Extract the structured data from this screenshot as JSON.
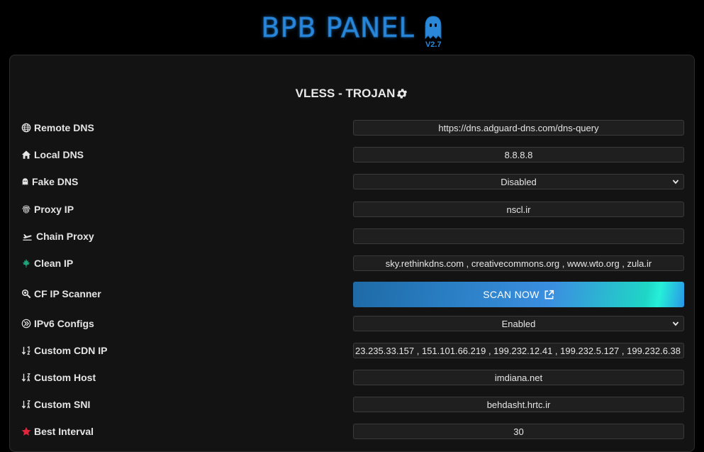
{
  "header": {
    "logo": "BPB PANEL",
    "version": "V2.7"
  },
  "section": {
    "title": "VLESS - TROJAN"
  },
  "rows": {
    "remote_dns": {
      "label": "Remote DNS",
      "value": "https://dns.adguard-dns.com/dns-query"
    },
    "local_dns": {
      "label": "Local DNS",
      "value": "8.8.8.8"
    },
    "fake_dns": {
      "label": "Fake DNS",
      "value": "Disabled"
    },
    "proxy_ip": {
      "label": "Proxy IP",
      "value": "nscl.ir"
    },
    "chain_proxy": {
      "label": "Chain Proxy",
      "value": ""
    },
    "clean_ip": {
      "label": "Clean IP",
      "value": "sky.rethinkdns.com , creativecommons.org , www.wto.org , zula.ir"
    },
    "cf_scanner": {
      "label": "CF IP Scanner",
      "button": "SCAN NOW"
    },
    "ipv6": {
      "label": "IPv6 Configs",
      "value": "Enabled"
    },
    "custom_cdn_ip": {
      "label": "Custom CDN IP",
      "value": "23.235.33.157 , 151.101.66.219 , 199.232.12.41 , 199.232.5.127 , 199.232.6.38 ,"
    },
    "custom_host": {
      "label": "Custom Host",
      "value": "imdiana.net"
    },
    "custom_sni": {
      "label": "Custom SNI",
      "value": "behdasht.hrtc.ir"
    },
    "best_interval": {
      "label": "Best Interval",
      "value": "30"
    }
  },
  "colors": {
    "accent": "#2b87d8",
    "leaf": "#1fa37a",
    "star": "#e0243c"
  },
  "icons": {
    "remote_dns": "globe-icon",
    "local_dns": "house-icon",
    "fake_dns": "ghost-icon",
    "proxy_ip": "fingerprint-icon",
    "chain_proxy": "plane-departure-icon",
    "clean_ip": "leaf-icon",
    "cf_scanner": "magnifier-icon",
    "ipv6": "ipv6-icon",
    "sort": "sort-arrows-icon",
    "best_interval": "star-icon",
    "gear": "gear-icon",
    "external": "external-link-icon"
  }
}
